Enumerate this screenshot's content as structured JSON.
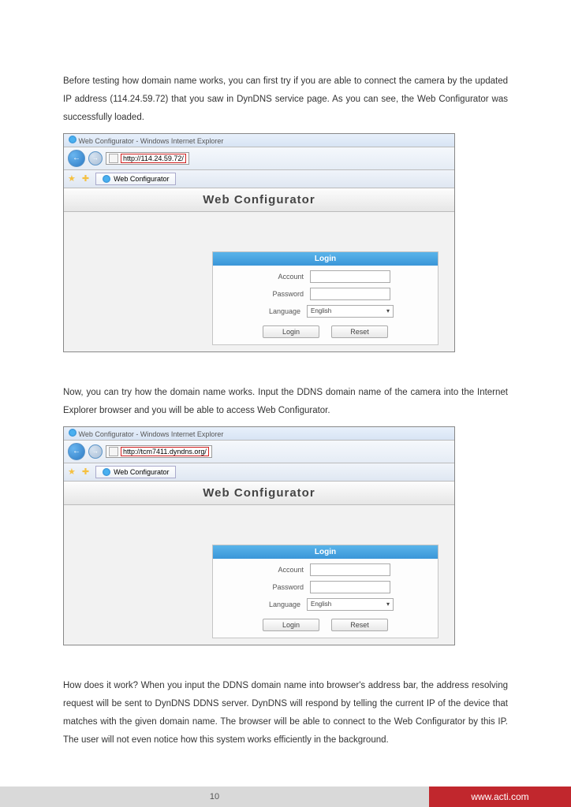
{
  "para1": "Before testing how domain name works, you can first try if you are able to connect the camera by the updated IP address (114.24.59.72) that you saw in DynDNS service page. As you can see, the Web Configurator was successfully loaded.",
  "para2": "Now, you can try how the domain name works. Input the DDNS domain name of the camera into the Internet Explorer browser and you will be able to access Web Configurator.",
  "para3": "How does it work? When you input the DDNS domain name into browser's address bar, the address resolving request will be sent to DynDNS DDNS server. DynDNS will respond by telling the current IP of the device that matches with the given domain name. The browser will be able to connect to the Web Configurator by this IP. The user will not even notice how this system works efficiently in the background.",
  "shot1": {
    "windowTitle": "Web Configurator - Windows Internet Explorer",
    "url": "http://114.24.59.72/",
    "tabName": "Web Configurator",
    "pageHeader": "Web Configurator",
    "login": {
      "title": "Login",
      "accountLabel": "Account",
      "passwordLabel": "Password",
      "languageLabel": "Language",
      "languageValue": "English",
      "loginBtn": "Login",
      "resetBtn": "Reset"
    }
  },
  "shot2": {
    "windowTitle": "Web Configurator - Windows Internet Explorer",
    "url": "http://tcm7411.dyndns.org/",
    "tabName": "Web Configurator",
    "pageHeader": "Web Configurator",
    "login": {
      "title": "Login",
      "accountLabel": "Account",
      "passwordLabel": "Password",
      "languageLabel": "Language",
      "languageValue": "English",
      "loginBtn": "Login",
      "resetBtn": "Reset"
    }
  },
  "footer": {
    "pageNum": "10",
    "site": "www.acti.com"
  }
}
